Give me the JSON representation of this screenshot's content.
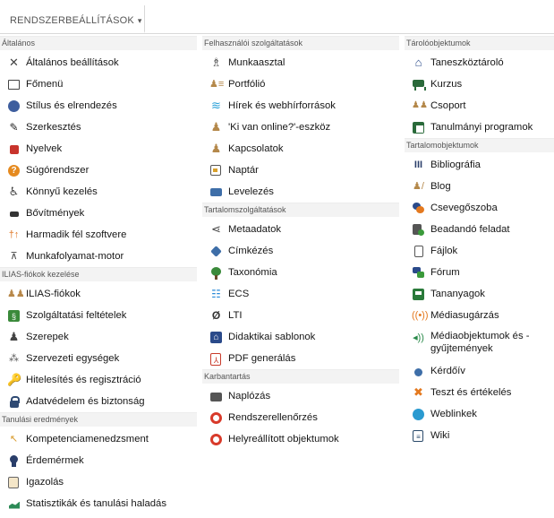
{
  "tab": {
    "label": "RENDSZERBEÁLLÍTÁSOK",
    "caret": "▾"
  },
  "col1": {
    "general": {
      "title": "Általános",
      "items": [
        {
          "label": "Általános beállítások"
        },
        {
          "label": "Főmenü"
        },
        {
          "label": "Stílus és elrendezés"
        },
        {
          "label": "Szerkesztés"
        },
        {
          "label": "Nyelvek"
        },
        {
          "label": "Súgórendszer"
        },
        {
          "label": "Könnyű kezelés"
        },
        {
          "label": "Bővítmények"
        },
        {
          "label": "Harmadik fél szoftvere"
        },
        {
          "label": "Munkafolyamat-motor"
        }
      ]
    },
    "accounts": {
      "title": "ILIAS-fiókok kezelése",
      "items": [
        {
          "label": "ILIAS-fiókok"
        },
        {
          "label": "Szolgáltatási feltételek"
        },
        {
          "label": "Szerepek"
        },
        {
          "label": "Szervezeti egységek"
        },
        {
          "label": "Hitelesítés és regisztráció"
        },
        {
          "label": "Adatvédelem és biztonság"
        }
      ]
    },
    "results": {
      "title": "Tanulási eredmények",
      "items": [
        {
          "label": "Kompetenciamenedzsment"
        },
        {
          "label": "Érdemérmek"
        },
        {
          "label": "Igazolás"
        },
        {
          "label": "Statisztikák és tanulási haladás"
        }
      ]
    }
  },
  "col2": {
    "user_services": {
      "title": "Felhasználói szolgáltatások",
      "items": [
        {
          "label": "Munkaasztal"
        },
        {
          "label": "Portfólió"
        },
        {
          "label": "Hírek és webhírforrások"
        },
        {
          "label": "'Ki van online?'-eszköz"
        },
        {
          "label": "Kapcsolatok"
        },
        {
          "label": "Naptár"
        },
        {
          "label": "Levelezés"
        }
      ]
    },
    "content_services": {
      "title": "Tartalomszolgáltatások",
      "items": [
        {
          "label": "Metaadatok"
        },
        {
          "label": "Címkézés"
        },
        {
          "label": "Taxonómia"
        },
        {
          "label": "ECS"
        },
        {
          "label": "LTI"
        },
        {
          "label": "Didaktikai sablonok"
        },
        {
          "label": "PDF generálás"
        }
      ]
    },
    "maintenance": {
      "title": "Karbantartás",
      "items": [
        {
          "label": "Naplózás"
        },
        {
          "label": "Rendszerellenőrzés"
        },
        {
          "label": "Helyreállított objektumok"
        }
      ]
    }
  },
  "col3": {
    "containers": {
      "title": "Tárolóobjektumok",
      "items": [
        {
          "label": "Taneszköztároló"
        },
        {
          "label": "Kurzus"
        },
        {
          "label": "Csoport"
        },
        {
          "label": "Tanulmányi programok"
        }
      ]
    },
    "content_objects": {
      "title": "Tartalomobjektumok",
      "items": [
        {
          "label": "Bibliográfia"
        },
        {
          "label": "Blog"
        },
        {
          "label": "Csevegőszoba"
        },
        {
          "label": "Beadandó feladat"
        },
        {
          "label": "Fájlok"
        },
        {
          "label": "Fórum"
        },
        {
          "label": "Tananyagok"
        },
        {
          "label": "Médiasugárzás"
        },
        {
          "label": "Médiaobjektumok és -gyűjtemények"
        },
        {
          "label": "Kérdőív"
        },
        {
          "label": "Teszt és értékelés"
        },
        {
          "label": "Weblinkek"
        },
        {
          "label": "Wiki"
        }
      ]
    }
  }
}
